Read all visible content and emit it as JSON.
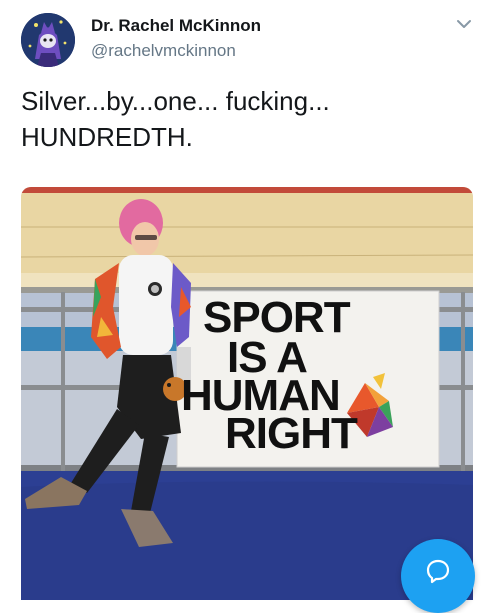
{
  "author": {
    "display_name": "Dr. Rachel McKinnon",
    "handle": "@rachelvmckinnon",
    "avatar_icon": "avatar-image"
  },
  "tweet": {
    "text_lines": [
      "Silver...by...one... fucking...",
      "HUNDREDTH."
    ]
  },
  "media": {
    "banner_lines": [
      "SPORT",
      "IS A",
      "HUMAN",
      "RIGHT"
    ],
    "icons": [
      "velodrome-photo",
      "medal-icon",
      "fox-mascot-icon"
    ]
  },
  "icons": {
    "caret": "chevron-down-icon",
    "fab": "reply-bubble-icon"
  },
  "colors": {
    "accent": "#1da1f2",
    "text": "#14171a",
    "secondary": "#657786",
    "track_floor": "#2b3d8f",
    "track_wood": "#e8d5a5"
  }
}
